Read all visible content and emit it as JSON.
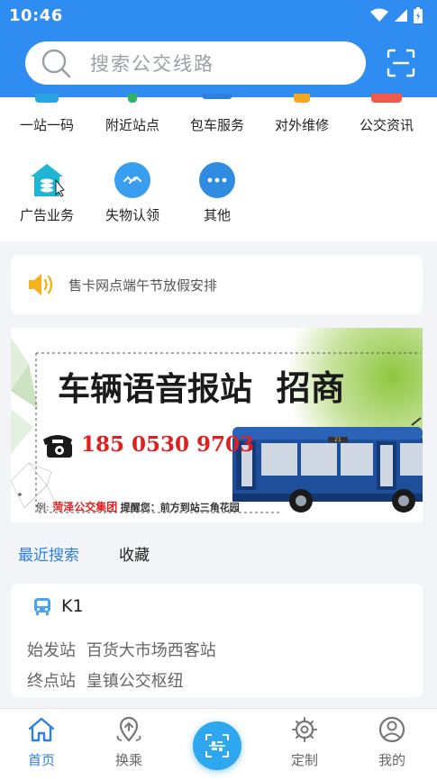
{
  "status_bar": {
    "time": "10:46"
  },
  "search": {
    "placeholder": "搜索公交线路"
  },
  "services_row1": [
    {
      "label": "一站一码",
      "icon": "qrcode-icon",
      "color": "#2aa4e0"
    },
    {
      "label": "附近站点",
      "icon": "nearby-icon",
      "color": "#2fb36b"
    },
    {
      "label": "包车服务",
      "icon": "charter-bus-icon",
      "color": "#2f7fe0"
    },
    {
      "label": "对外维修",
      "icon": "repair-icon",
      "color": "#f5a623"
    },
    {
      "label": "公交资讯",
      "icon": "news-icon",
      "color": "#f05a4a"
    }
  ],
  "services_row2": [
    {
      "label": "广告业务",
      "icon": "advertising-icon",
      "color": "#1fb5d4"
    },
    {
      "label": "失物认领",
      "icon": "lost-found-icon",
      "color": "#3a9ef0"
    },
    {
      "label": "其他",
      "icon": "more-icon",
      "color": "#2f8ce0"
    }
  ],
  "notice": {
    "text": "售卡网点端午节放假安排"
  },
  "banner": {
    "headline": "车辆语音报站",
    "headline_emphasis": "招商",
    "phone": "185 0530 9703",
    "example_prefix": "例:",
    "example_company": "菏泽公交集团",
    "example_text": "提醒您：前方到站三角花园",
    "bus_route_tag": "21"
  },
  "tabs": [
    {
      "label": "最近搜索",
      "active": true
    },
    {
      "label": "收藏",
      "active": false
    }
  ],
  "route_card": {
    "name": "K1",
    "start_label": "始发站",
    "start_station": "百货大市场西客站",
    "end_label": "终点站",
    "end_station": "皇镇公交枢纽"
  },
  "bottom_nav": [
    {
      "label": "首页",
      "icon": "home-icon",
      "active": true
    },
    {
      "label": "换乘",
      "icon": "transfer-icon",
      "active": false
    },
    {
      "label": "定制",
      "icon": "custom-icon",
      "active": false
    },
    {
      "label": "我的",
      "icon": "profile-icon",
      "active": false
    }
  ],
  "colors": {
    "primary": "#2f8cf0",
    "active_text": "#2f7fe0",
    "center_button": "#2ea7f0"
  }
}
